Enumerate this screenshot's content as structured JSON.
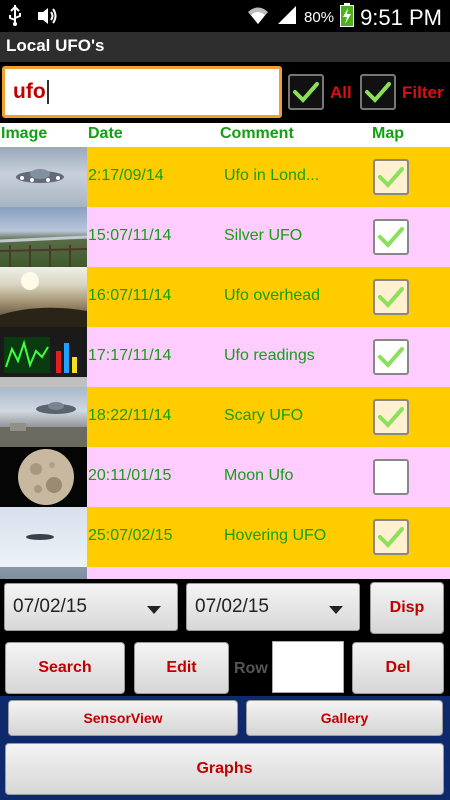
{
  "status_bar": {
    "battery_percent": "80%",
    "time": "9:51 PM",
    "left_icons": [
      "usb-icon",
      "wifi-audio-icon"
    ],
    "right_icons": [
      "wifi-signal-icon",
      "cell-signal-icon",
      "battery-charging-icon"
    ]
  },
  "app": {
    "title": "Local UFO's"
  },
  "search": {
    "value": "ufo"
  },
  "filters": {
    "all": {
      "label": "All",
      "checked": true
    },
    "filter": {
      "label": "Filter",
      "checked": true
    }
  },
  "table": {
    "headers": {
      "image": "Image",
      "date": "Date",
      "comment": "Comment",
      "map": "Map"
    },
    "rows": [
      {
        "date": "2:17/09/14",
        "comment": "Ufo in Lond...",
        "map": true,
        "bg": "#ffcc00"
      },
      {
        "date": "15:07/11/14",
        "comment": "Silver UFO",
        "map": true,
        "bg": "#ffccff"
      },
      {
        "date": "16:07/11/14",
        "comment": "Ufo overhead",
        "map": true,
        "bg": "#ffcc00"
      },
      {
        "date": "17:17/11/14",
        "comment": "Ufo readings",
        "map": true,
        "bg": "#ffccff"
      },
      {
        "date": "18:22/11/14",
        "comment": "Scary UFO",
        "map": true,
        "bg": "#ffcc00"
      },
      {
        "date": "20:11/01/15",
        "comment": "Moon Ufo",
        "map": false,
        "bg": "#ffccff"
      },
      {
        "date": "25:07/02/15",
        "comment": "Hovering UFO",
        "map": true,
        "bg": "#ffcc00"
      },
      {
        "date": "",
        "comment": "",
        "map": false,
        "bg": "#ffccff"
      }
    ]
  },
  "controls": {
    "date_from": "07/02/15",
    "date_to": "07/02/15",
    "disp": "Disp",
    "search": "Search",
    "edit": "Edit",
    "row_label": "Row",
    "row_value": "",
    "del": "Del",
    "sensor_view": "SensorView",
    "gallery": "Gallery",
    "graphs": "Graphs"
  },
  "colors": {
    "header_text": "#12a012",
    "button_text": "#c00000",
    "row_yellow": "#ffcc00",
    "row_pink": "#ffccff",
    "search_border": "#f0a030",
    "nav_bg": "#0d2a6c"
  }
}
